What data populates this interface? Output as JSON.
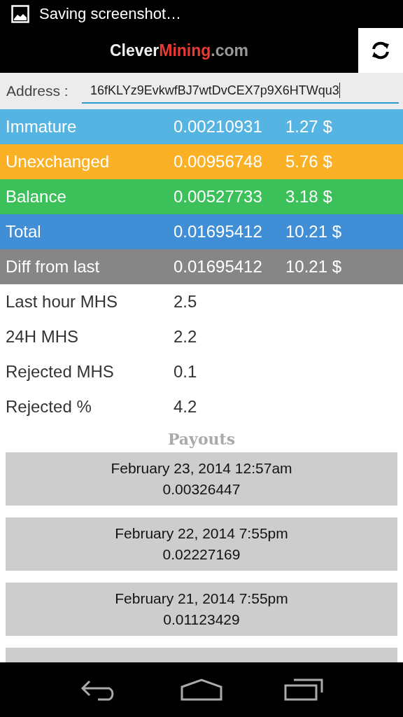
{
  "status_bar": {
    "notification": "Saving screenshot…"
  },
  "action_bar": {
    "logo": [
      {
        "text": "Clever",
        "kind": "light"
      },
      {
        "text": "Mining",
        "kind": "accent"
      },
      {
        "text": ".com",
        "kind": "muted"
      }
    ]
  },
  "address": {
    "label": "Address :",
    "value": "16fKLYz9EvkwfBJ7wtDvCEX7p9X6HTWqu3"
  },
  "balances": [
    {
      "label": "Immature",
      "btc": "0.00210931",
      "usd": "1.27 $",
      "color": "#56b4e3"
    },
    {
      "label": "Unexchanged",
      "btc": "0.00956748",
      "usd": "5.76 $",
      "color": "#fbb126"
    },
    {
      "label": "Balance",
      "btc": "0.00527733",
      "usd": "3.18 $",
      "color": "#3cc05a"
    },
    {
      "label": "Total",
      "btc": "0.01695412",
      "usd": "10.21 $",
      "color": "#3f8ed6"
    },
    {
      "label": "Diff from last",
      "btc": "0.01695412",
      "usd": "10.21 $",
      "color": "#868686"
    }
  ],
  "stats": [
    {
      "label": "Last hour MHS",
      "value": "2.5"
    },
    {
      "label": "24H MHS",
      "value": "2.2"
    },
    {
      "label": "Rejected MHS",
      "value": "0.1"
    },
    {
      "label": "Rejected %",
      "value": "4.2"
    }
  ],
  "payouts": {
    "title": "Payouts",
    "items": [
      {
        "kind": "full",
        "date": "February 23, 2014 12:57am",
        "amount": "0.00326447"
      },
      {
        "kind": "full",
        "date": "February 22, 2014 7:55pm",
        "amount": "0.02227169"
      },
      {
        "kind": "full",
        "date": "February 21, 2014 7:55pm",
        "amount": "0.01123429"
      },
      {
        "kind": "cut_off"
      }
    ]
  }
}
